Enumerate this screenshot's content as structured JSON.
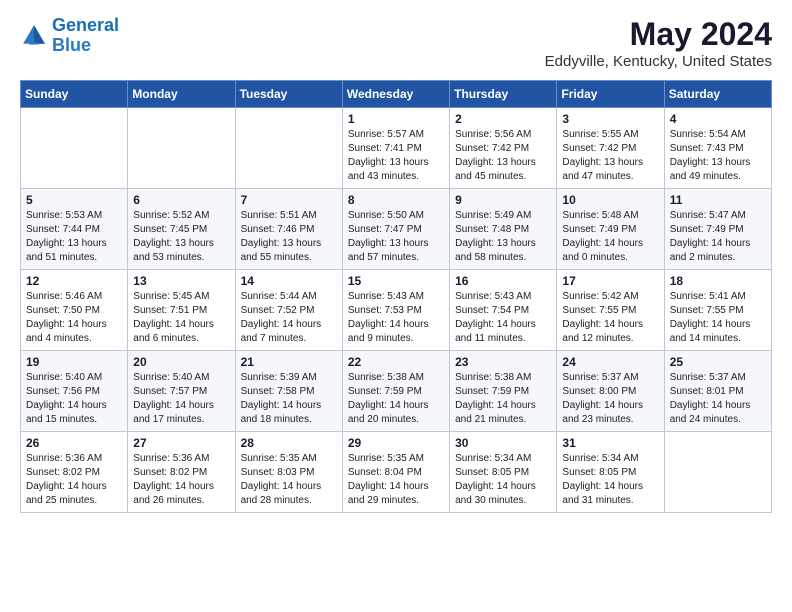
{
  "logo": {
    "line1": "General",
    "line2": "Blue"
  },
  "title": "May 2024",
  "subtitle": "Eddyville, Kentucky, United States",
  "weekdays": [
    "Sunday",
    "Monday",
    "Tuesday",
    "Wednesday",
    "Thursday",
    "Friday",
    "Saturday"
  ],
  "weeks": [
    [
      {
        "day": "",
        "info": ""
      },
      {
        "day": "",
        "info": ""
      },
      {
        "day": "",
        "info": ""
      },
      {
        "day": "1",
        "info": "Sunrise: 5:57 AM\nSunset: 7:41 PM\nDaylight: 13 hours\nand 43 minutes."
      },
      {
        "day": "2",
        "info": "Sunrise: 5:56 AM\nSunset: 7:42 PM\nDaylight: 13 hours\nand 45 minutes."
      },
      {
        "day": "3",
        "info": "Sunrise: 5:55 AM\nSunset: 7:42 PM\nDaylight: 13 hours\nand 47 minutes."
      },
      {
        "day": "4",
        "info": "Sunrise: 5:54 AM\nSunset: 7:43 PM\nDaylight: 13 hours\nand 49 minutes."
      }
    ],
    [
      {
        "day": "5",
        "info": "Sunrise: 5:53 AM\nSunset: 7:44 PM\nDaylight: 13 hours\nand 51 minutes."
      },
      {
        "day": "6",
        "info": "Sunrise: 5:52 AM\nSunset: 7:45 PM\nDaylight: 13 hours\nand 53 minutes."
      },
      {
        "day": "7",
        "info": "Sunrise: 5:51 AM\nSunset: 7:46 PM\nDaylight: 13 hours\nand 55 minutes."
      },
      {
        "day": "8",
        "info": "Sunrise: 5:50 AM\nSunset: 7:47 PM\nDaylight: 13 hours\nand 57 minutes."
      },
      {
        "day": "9",
        "info": "Sunrise: 5:49 AM\nSunset: 7:48 PM\nDaylight: 13 hours\nand 58 minutes."
      },
      {
        "day": "10",
        "info": "Sunrise: 5:48 AM\nSunset: 7:49 PM\nDaylight: 14 hours\nand 0 minutes."
      },
      {
        "day": "11",
        "info": "Sunrise: 5:47 AM\nSunset: 7:49 PM\nDaylight: 14 hours\nand 2 minutes."
      }
    ],
    [
      {
        "day": "12",
        "info": "Sunrise: 5:46 AM\nSunset: 7:50 PM\nDaylight: 14 hours\nand 4 minutes."
      },
      {
        "day": "13",
        "info": "Sunrise: 5:45 AM\nSunset: 7:51 PM\nDaylight: 14 hours\nand 6 minutes."
      },
      {
        "day": "14",
        "info": "Sunrise: 5:44 AM\nSunset: 7:52 PM\nDaylight: 14 hours\nand 7 minutes."
      },
      {
        "day": "15",
        "info": "Sunrise: 5:43 AM\nSunset: 7:53 PM\nDaylight: 14 hours\nand 9 minutes."
      },
      {
        "day": "16",
        "info": "Sunrise: 5:43 AM\nSunset: 7:54 PM\nDaylight: 14 hours\nand 11 minutes."
      },
      {
        "day": "17",
        "info": "Sunrise: 5:42 AM\nSunset: 7:55 PM\nDaylight: 14 hours\nand 12 minutes."
      },
      {
        "day": "18",
        "info": "Sunrise: 5:41 AM\nSunset: 7:55 PM\nDaylight: 14 hours\nand 14 minutes."
      }
    ],
    [
      {
        "day": "19",
        "info": "Sunrise: 5:40 AM\nSunset: 7:56 PM\nDaylight: 14 hours\nand 15 minutes."
      },
      {
        "day": "20",
        "info": "Sunrise: 5:40 AM\nSunset: 7:57 PM\nDaylight: 14 hours\nand 17 minutes."
      },
      {
        "day": "21",
        "info": "Sunrise: 5:39 AM\nSunset: 7:58 PM\nDaylight: 14 hours\nand 18 minutes."
      },
      {
        "day": "22",
        "info": "Sunrise: 5:38 AM\nSunset: 7:59 PM\nDaylight: 14 hours\nand 20 minutes."
      },
      {
        "day": "23",
        "info": "Sunrise: 5:38 AM\nSunset: 7:59 PM\nDaylight: 14 hours\nand 21 minutes."
      },
      {
        "day": "24",
        "info": "Sunrise: 5:37 AM\nSunset: 8:00 PM\nDaylight: 14 hours\nand 23 minutes."
      },
      {
        "day": "25",
        "info": "Sunrise: 5:37 AM\nSunset: 8:01 PM\nDaylight: 14 hours\nand 24 minutes."
      }
    ],
    [
      {
        "day": "26",
        "info": "Sunrise: 5:36 AM\nSunset: 8:02 PM\nDaylight: 14 hours\nand 25 minutes."
      },
      {
        "day": "27",
        "info": "Sunrise: 5:36 AM\nSunset: 8:02 PM\nDaylight: 14 hours\nand 26 minutes."
      },
      {
        "day": "28",
        "info": "Sunrise: 5:35 AM\nSunset: 8:03 PM\nDaylight: 14 hours\nand 28 minutes."
      },
      {
        "day": "29",
        "info": "Sunrise: 5:35 AM\nSunset: 8:04 PM\nDaylight: 14 hours\nand 29 minutes."
      },
      {
        "day": "30",
        "info": "Sunrise: 5:34 AM\nSunset: 8:05 PM\nDaylight: 14 hours\nand 30 minutes."
      },
      {
        "day": "31",
        "info": "Sunrise: 5:34 AM\nSunset: 8:05 PM\nDaylight: 14 hours\nand 31 minutes."
      },
      {
        "day": "",
        "info": ""
      }
    ]
  ]
}
